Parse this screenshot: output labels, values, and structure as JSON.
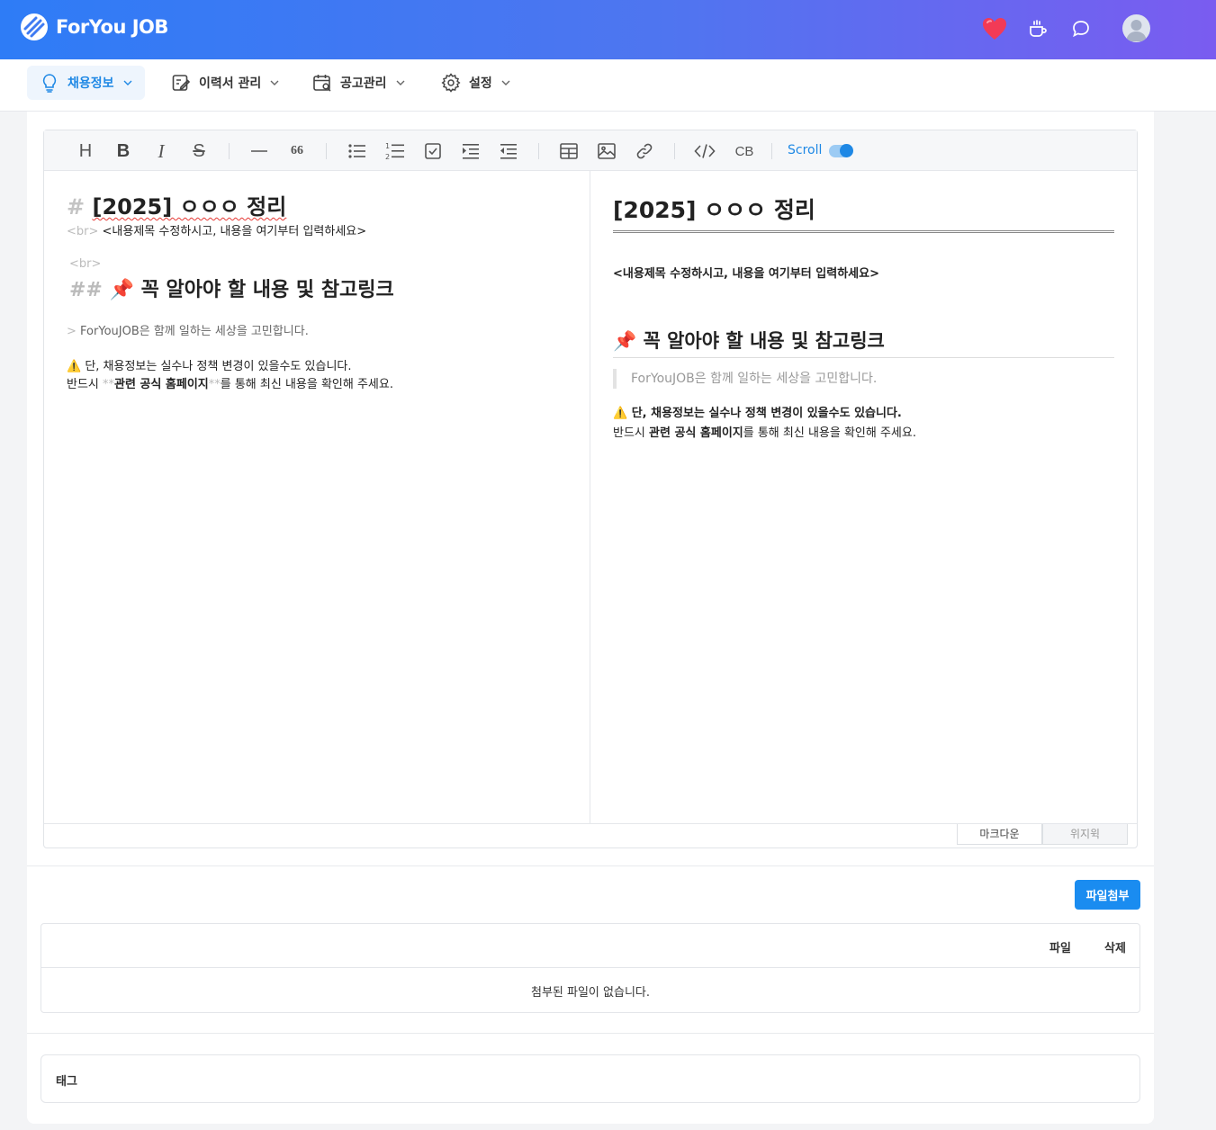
{
  "app": {
    "brand": "ForYou JOB",
    "header_icons": [
      "heart-icon",
      "coffee-icon",
      "chat-bubble-icon",
      "user-avatar"
    ]
  },
  "nav": {
    "items": [
      {
        "label": "채용정보",
        "icon": "lightbulb-icon",
        "active": true
      },
      {
        "label": "이력서 관리",
        "icon": "edit-document-icon",
        "active": false
      },
      {
        "label": "공고관리",
        "icon": "calendar-search-icon",
        "active": false
      },
      {
        "label": "설정",
        "icon": "gear-icon",
        "active": false
      }
    ]
  },
  "toolbar": {
    "heading": "H",
    "bold": "B",
    "italic": "I",
    "strike": "S",
    "quote": "66",
    "codeblock": "CB",
    "scroll_label": "Scroll",
    "scroll_sync": true
  },
  "markdown_source": {
    "h1_marker": "#",
    "h1_text": "[2025] ㅇㅇㅇ 정리",
    "br_tag": "<br>",
    "intro": "<내용제목 수정하시고, 내용을 여기부터 입력하세요>",
    "br_tag2": "<br>",
    "h2_marker": "##",
    "h2_text": "📌 꼭 알아야 할 내용 및 참고링크",
    "quote_marker": ">",
    "quote_text": "ForYouJOB은 함께 일하는 세상을 고민합니다.",
    "warning_line": "⚠️ 단, 채용정보는 실수나 정책 변경이 있을수도 있습니다.",
    "line2_prefix": "반드시 ",
    "bold_marker": "**",
    "bold_text": "관련 공식 홈페이지",
    "line2_suffix": "를 통해 최신 내용을 확인해 주세요."
  },
  "preview": {
    "h1": "[2025] ㅇㅇㅇ 정리",
    "intro": "<내용제목 수정하시고, 내용을 여기부터 입력하세요>",
    "h2": "📌 꼭 알아야 할 내용 및 참고링크",
    "quote": "ForYouJOB은 함께 일하는 세상을 고민합니다.",
    "warning_line": "⚠️ 단, 채용정보는 실수나 정책 변경이 있을수도 있습니다.",
    "line2_prefix": "반드시 ",
    "bold_text": "관련 공식 홈페이지",
    "line2_suffix": "를 통해 최신 내용을 확인해 주세요."
  },
  "editor_tabs": {
    "markdown": "마크다운",
    "wysiwyg": "위지윅"
  },
  "attachments": {
    "button": "파일첨부",
    "col_file": "파일",
    "col_delete": "삭제",
    "empty": "첨부된 파일이 없습니다."
  },
  "tags": {
    "label": "태그"
  },
  "colors": {
    "header_gradient_start": "#2e7cf6",
    "header_gradient_end": "#7a5cf0",
    "accent": "#1e88e5",
    "active_nav_bg": "#eef5fd"
  }
}
